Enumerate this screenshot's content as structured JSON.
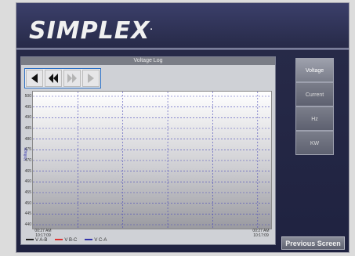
{
  "brand": {
    "name": "SIMPLEX",
    "mark": "."
  },
  "panel": {
    "title": "Voltage Log"
  },
  "nav": [
    "first-icon",
    "rewind-icon",
    "fast-forward-icon",
    "last-icon"
  ],
  "side_buttons": [
    {
      "label": "Voltage",
      "active": true
    },
    {
      "label": "Current",
      "active": false
    },
    {
      "label": "Hz",
      "active": false
    },
    {
      "label": "KW",
      "active": false
    }
  ],
  "previous_screen_label": "Previous Screen",
  "chart_data": {
    "type": "line",
    "title": "Voltage Log",
    "ylabel": "Voltage",
    "y_ticks": [
      500,
      495,
      490,
      485,
      480,
      475,
      470,
      465,
      460,
      455,
      450,
      445,
      440
    ],
    "ylim": [
      440,
      500
    ],
    "x_ticks": [
      "00:27 AM\n10:17:09",
      "00:27 AM\n10:17:09"
    ],
    "legend": [
      "V A-B",
      "V B-C",
      "V C-A"
    ],
    "series": []
  }
}
